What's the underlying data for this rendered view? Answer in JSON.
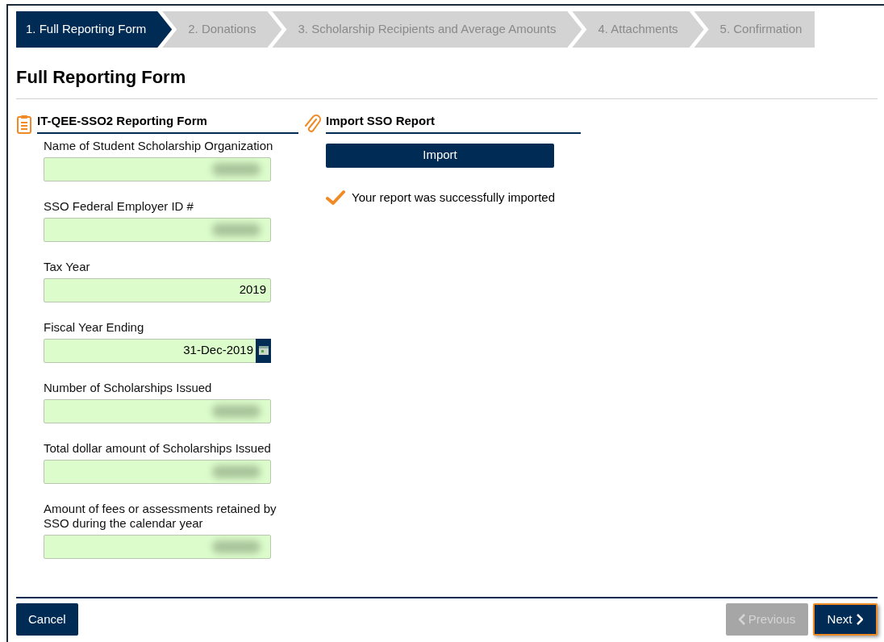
{
  "steps": [
    {
      "label": "1. Full Reporting Form",
      "selected": true
    },
    {
      "label": "2. Donations",
      "selected": false
    },
    {
      "label": "3. Scholarship Recipients and Average Amounts",
      "selected": false
    },
    {
      "label": "4. Attachments",
      "selected": false
    },
    {
      "label": "5. Confirmation",
      "selected": false
    }
  ],
  "page_title": "Full Reporting Form",
  "form_section": {
    "title": "IT-QEE-SSO2 Reporting Form",
    "fields": [
      {
        "label": "Name of Student Scholarship Organization",
        "kind": "blurred"
      },
      {
        "label": "SSO Federal Employer ID #",
        "kind": "blurred"
      },
      {
        "label": "Tax Year",
        "kind": "text",
        "value": "2019"
      },
      {
        "label": "Fiscal Year Ending",
        "kind": "date",
        "value": "31-Dec-2019"
      },
      {
        "label": "Number of Scholarships Issued",
        "kind": "blurred"
      },
      {
        "label": "Total dollar amount of Scholarships Issued",
        "kind": "blurred"
      },
      {
        "label": "Amount of fees or assessments retained by SSO during the calendar year",
        "kind": "blurred"
      }
    ]
  },
  "import_section": {
    "title": "Import SSO Report",
    "button": "Import",
    "message": "Your report was successfully imported"
  },
  "footer": {
    "cancel": "Cancel",
    "previous": {
      "label": "Previous",
      "disabled": true
    },
    "next": {
      "label": "Next",
      "disabled": false
    }
  }
}
